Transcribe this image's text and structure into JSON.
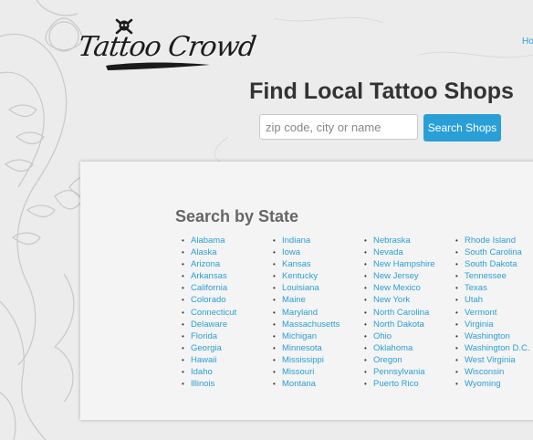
{
  "header": {
    "logo_text": "Tattoo Crowd",
    "nav_link": "Ho"
  },
  "hero": {
    "title": "Find Local Tattoo Shops",
    "search_placeholder": "zip code, city or name",
    "search_button": "Search Shops"
  },
  "states_section": {
    "title": "Search by State",
    "columns": [
      [
        "Alabama",
        "Alaska",
        "Arizona",
        "Arkansas",
        "California",
        "Colorado",
        "Connecticut",
        "Delaware",
        "Florida",
        "Georgia",
        "Hawaii",
        "Idaho",
        "Illinois"
      ],
      [
        "Indiana",
        "Iowa",
        "Kansas",
        "Kentucky",
        "Louisiana",
        "Maine",
        "Maryland",
        "Massachusetts",
        "Michigan",
        "Minnesota",
        "Mississippi",
        "Missouri",
        "Montana"
      ],
      [
        "Nebraska",
        "Nevada",
        "New Hampshire",
        "New Jersey",
        "New Mexico",
        "New York",
        "North Carolina",
        "North Dakota",
        "Ohio",
        "Oklahoma",
        "Oregon",
        "Pennsylvania",
        "Puerto Rico"
      ],
      [
        "Rhode Island",
        "South Carolina",
        "South Dakota",
        "Tennessee",
        "Texas",
        "Utah",
        "Vermont",
        "Virginia",
        "Washington",
        "Washington D.C.",
        "West Virginia",
        "Wisconsin",
        "Wyoming"
      ]
    ]
  },
  "colors": {
    "accent": "#2a9fd6",
    "title_text": "#333333",
    "section_title": "#666666",
    "panel_bg": "#f4f4f4",
    "page_bg": "#ececec"
  }
}
